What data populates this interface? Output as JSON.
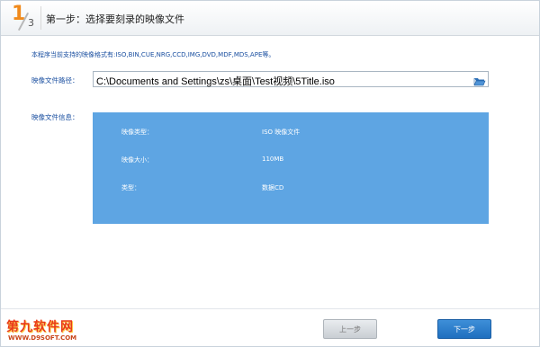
{
  "header": {
    "step_current": "1",
    "step_total": "3",
    "title": "第一步：选择要刻录的映像文件"
  },
  "support_text": "本程序当前支持的映像格式有:ISO,BIN,CUE,NRG,CCD,IMG,DVD,MDF,MDS,APE等。",
  "path": {
    "label": "映像文件路径：",
    "value": "C:\\Documents and Settings\\zs\\桌面\\Test视频\\5Title.iso",
    "browse_icon": "folder-open-icon"
  },
  "info": {
    "label": "映像文件信息：",
    "panel_color": "#5ea5e3",
    "rows": [
      {
        "key": "映像类型：",
        "value": "ISO 映像文件"
      },
      {
        "key": "映像大小：",
        "value": "110MB"
      },
      {
        "key": "类型：",
        "value": "数据CD"
      }
    ]
  },
  "footer": {
    "logo_main": "第九软件网",
    "logo_sub": "WWW.D9SOFT.COM",
    "prev_label": "上一步",
    "next_label": "下一步",
    "next_color": "#1f6fbf"
  }
}
